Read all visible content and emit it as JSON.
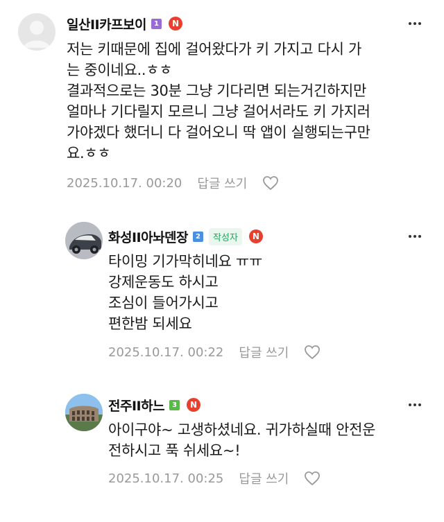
{
  "comments": [
    {
      "nickname": "일산II카프보이",
      "level": "1",
      "level_color": "#9a6bd6",
      "badge": "N",
      "lines": [
        "저는 키때문에 집에 걸어왔다가 키 가지고 다시 가",
        "는 중이네요..ㅎㅎ",
        "결과적으로는 30분 그냥 기다리면 되는거긴하지만",
        "얼마나 기다릴지 모르니 그냥 걸어서라도 키 가지러",
        "가야겠다 했더니 다 걸어오니 딱 앱이 실행되는구만",
        "요.ㅎㅎ"
      ],
      "timestamp": "2025.10.17. 00:20",
      "reply_label": "답글 쓰기"
    },
    {
      "nickname": "화성II아놔덴장",
      "level": "2",
      "level_color": "#4a8fe0",
      "author_tag": "작성자",
      "badge": "N",
      "lines": [
        "타이밍 기가막히네요 ㅠㅠ",
        "강제운동도 하시고",
        "조심이 들어가시고",
        "편한밤 되세요"
      ],
      "timestamp": "2025.10.17. 00:22",
      "reply_label": "답글 쓰기"
    },
    {
      "nickname": "전주II하느",
      "level": "3",
      "level_color": "#5bb84a",
      "badge": "N",
      "lines": [
        "아이구야~ 고생하셨네요. 귀가하실때 안전운",
        "전하시고 푹 쉬세요~!"
      ],
      "timestamp": "2025.10.17. 00:25",
      "reply_label": "답글 쓰기"
    }
  ]
}
